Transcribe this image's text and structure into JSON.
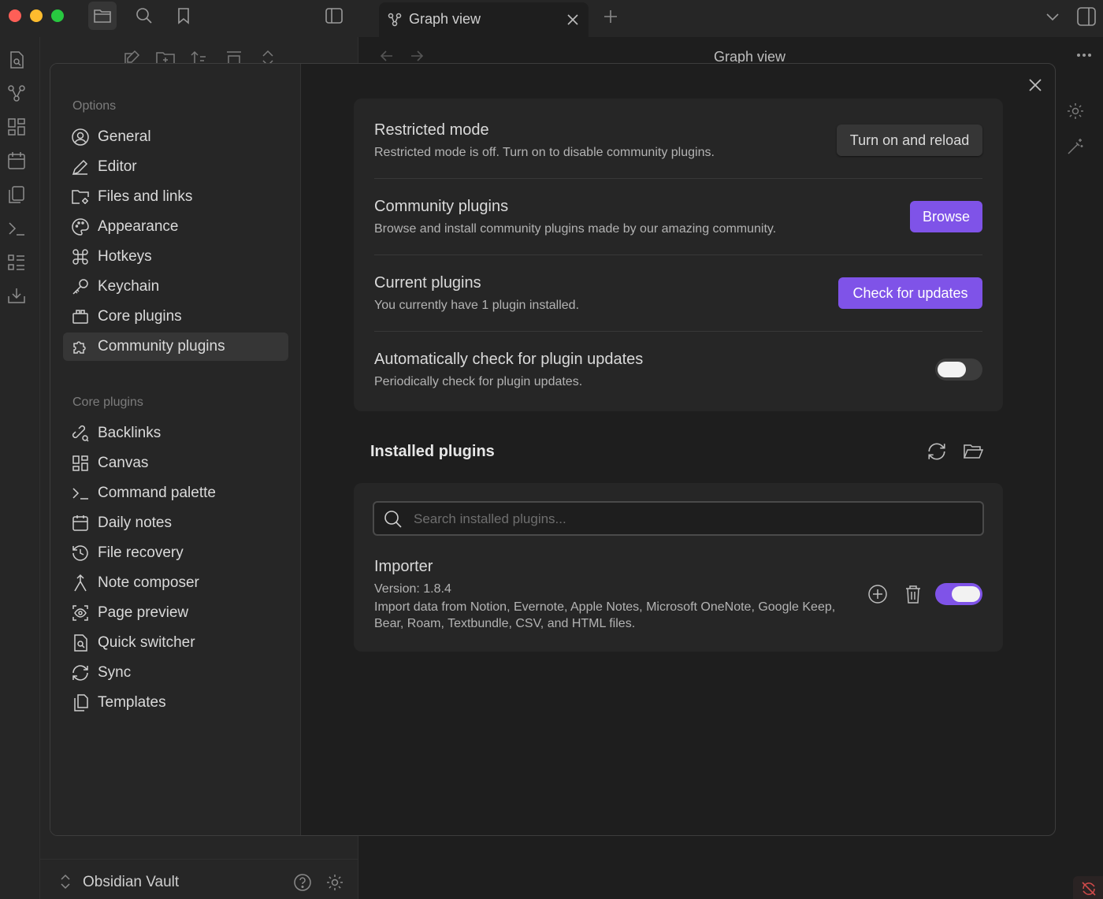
{
  "window": {
    "tab_title": "Graph view",
    "view_title": "Graph view"
  },
  "vault": {
    "name": "Obsidian Vault"
  },
  "settings_nav": {
    "options_heading": "Options",
    "options": [
      {
        "label": "General",
        "icon": "user-circle-icon"
      },
      {
        "label": "Editor",
        "icon": "pencil-icon"
      },
      {
        "label": "Files and links",
        "icon": "folder-cog-icon"
      },
      {
        "label": "Appearance",
        "icon": "palette-icon"
      },
      {
        "label": "Hotkeys",
        "icon": "command-icon"
      },
      {
        "label": "Keychain",
        "icon": "key-icon"
      },
      {
        "label": "Core plugins",
        "icon": "plug-icon"
      },
      {
        "label": "Community plugins",
        "icon": "puzzle-icon"
      }
    ],
    "core_heading": "Core plugins",
    "core": [
      {
        "label": "Backlinks",
        "icon": "link-search-icon"
      },
      {
        "label": "Canvas",
        "icon": "layout-dashboard-icon"
      },
      {
        "label": "Command palette",
        "icon": "terminal-icon"
      },
      {
        "label": "Daily notes",
        "icon": "calendar-icon"
      },
      {
        "label": "File recovery",
        "icon": "history-icon"
      },
      {
        "label": "Note composer",
        "icon": "merge-icon"
      },
      {
        "label": "Page preview",
        "icon": "scan-eye-icon"
      },
      {
        "label": "Quick switcher",
        "icon": "file-search-icon"
      },
      {
        "label": "Sync",
        "icon": "refresh-icon"
      },
      {
        "label": "Templates",
        "icon": "files-icon"
      }
    ]
  },
  "community": {
    "restricted": {
      "name": "Restricted mode",
      "desc": "Restricted mode is off. Turn on to disable community plugins.",
      "button": "Turn on and reload"
    },
    "browse": {
      "name": "Community plugins",
      "desc": "Browse and install community plugins made by our amazing community.",
      "button": "Browse"
    },
    "current": {
      "name": "Current plugins",
      "desc": "You currently have 1 plugin installed.",
      "button": "Check for updates"
    },
    "auto_check": {
      "name": "Automatically check for plugin updates",
      "desc": "Periodically check for plugin updates.",
      "enabled": false
    },
    "installed_heading": "Installed plugins",
    "search_placeholder": "Search installed plugins...",
    "plugin": {
      "name": "Importer",
      "version": "Version: 1.8.4",
      "desc": "Import data from Notion, Evernote, Apple Notes, Microsoft OneNote, Google Keep, Bear, Roam, Textbundle, CSV, and HTML files.",
      "enabled": true
    }
  },
  "colors": {
    "accent": "#7f53e8",
    "bg": "#1e1e1e",
    "panel": "#262626"
  }
}
